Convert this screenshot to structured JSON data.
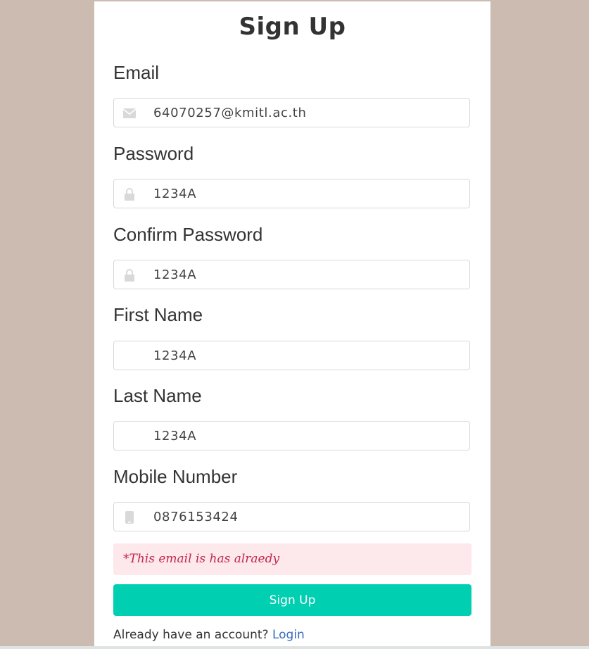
{
  "form": {
    "title": "Sign Up",
    "fields": {
      "email": {
        "label": "Email",
        "value": "64070257@kmitl.ac.th",
        "icon": "envelope-icon"
      },
      "password": {
        "label": "Password",
        "value": "1234A",
        "icon": "lock-icon"
      },
      "confirm_password": {
        "label": "Confirm Password",
        "value": "1234A",
        "icon": "lock-icon"
      },
      "first_name": {
        "label": "First Name",
        "value": "1234A"
      },
      "last_name": {
        "label": "Last Name",
        "value": "1234A"
      },
      "mobile": {
        "label": "Mobile Number",
        "value": "0876153424",
        "icon": "mobile-icon"
      }
    },
    "error_message": "*This email is has alraedy",
    "submit_label": "Sign Up",
    "footer_text": "Already have an account? ",
    "login_link": "Login"
  },
  "colors": {
    "background": "#cbbbb0",
    "accent": "#00cfb2",
    "error_bg": "#fde8ec",
    "error_text": "#c0284a",
    "link": "#3a6bc4"
  }
}
